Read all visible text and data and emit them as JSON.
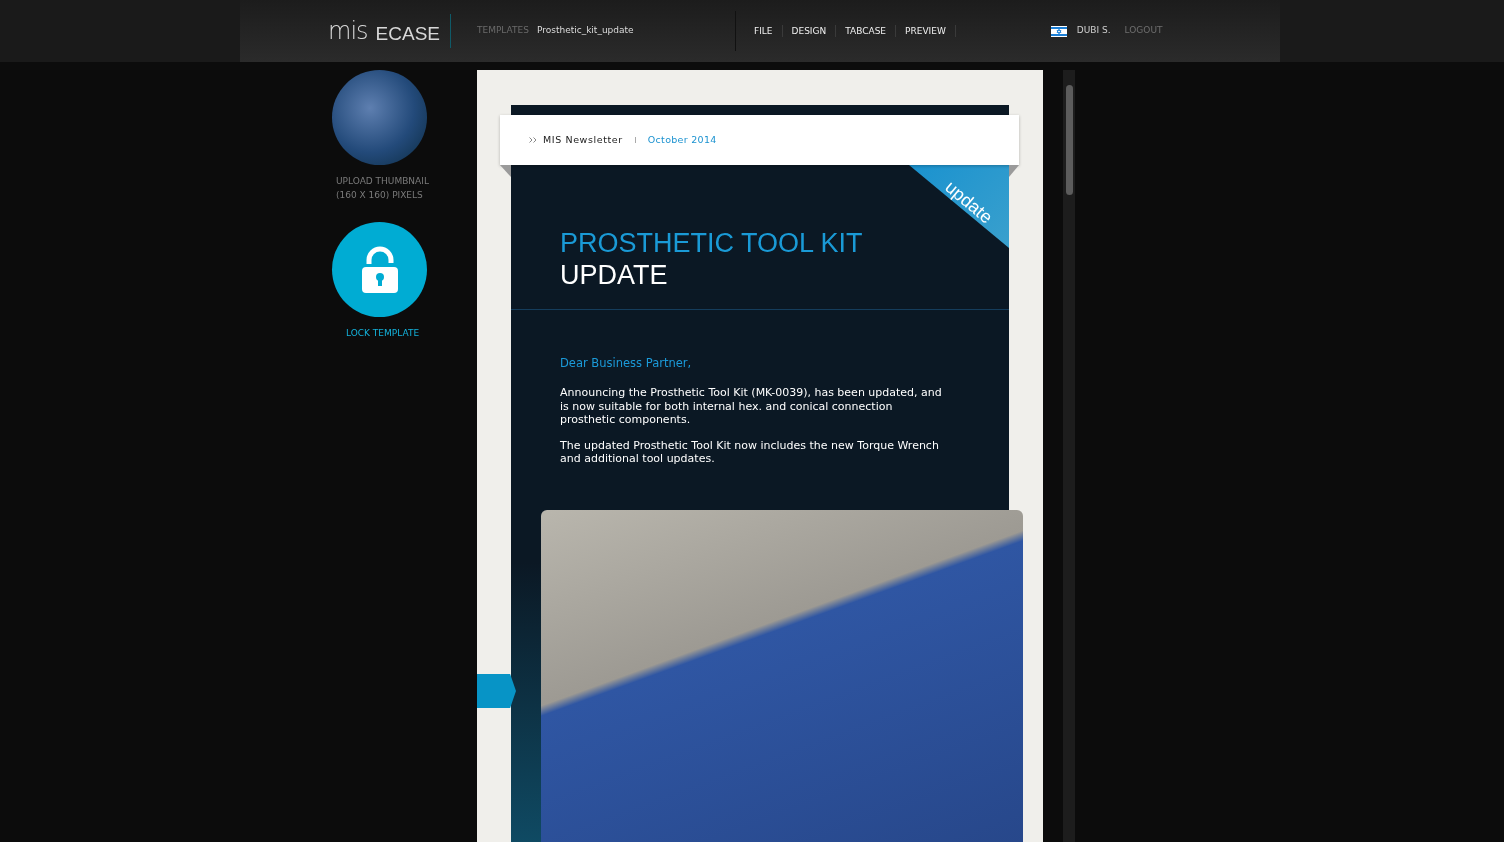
{
  "header": {
    "logo": {
      "mark": "mis",
      "name": "ECASE"
    },
    "breadcrumb": {
      "label": "TEMPLATES",
      "value": "Prosthetic_kit_update"
    },
    "menu": [
      {
        "label": "FILE"
      },
      {
        "label": "DESIGN"
      },
      {
        "label": "TABCASE"
      },
      {
        "label": "PREVIEW"
      }
    ],
    "user": {
      "name": "DUBI S.",
      "logout": "LOGOUT"
    }
  },
  "sidebar": {
    "thumbnail_caption": [
      "UPLOAD THUMBNAIL",
      "(160 X 160) PIXELS"
    ],
    "lock": {
      "label": "LOCK TEMPLATE",
      "locked": false
    }
  },
  "newsletter": {
    "publication": "MIS Newsletter",
    "date": "October 2014",
    "ribbon": "update",
    "title": "PROSTHETIC TOOL KIT",
    "subtitle": "UPDATE",
    "greeting": "Dear Business Partner,",
    "paragraphs": [
      "Announcing the Prosthetic Tool Kit (MK-0039), has been updated, and is now suitable for both internal hex. and conical connection prosthetic components.",
      "The updated Prosthetic Tool Kit now includes the new Torque Wrench and additional tool updates."
    ]
  }
}
